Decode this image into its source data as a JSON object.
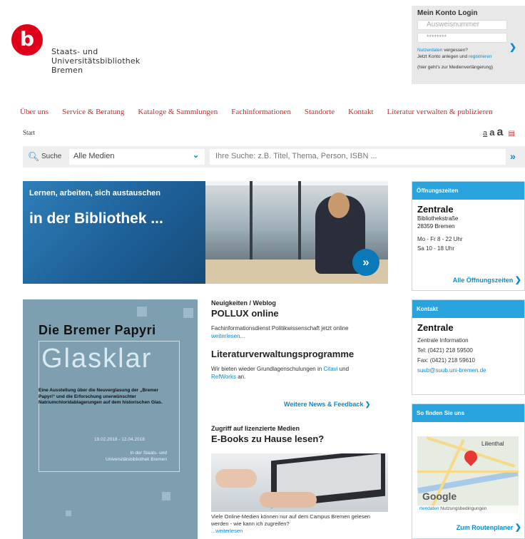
{
  "header": {
    "logo_letter": "b",
    "library_name_lines": [
      "Staats- und",
      "Universitätsbibliothek",
      "Bremen"
    ]
  },
  "login": {
    "title": "Mein Konto Login",
    "card_placeholder": "Ausweisnummer",
    "password_mask": "********",
    "line1_link": "Nutzerdaten",
    "line1_rest": " vergessen?",
    "line2_start": "Jetzt Konto anlegen und ",
    "line2_link": "registrieren",
    "line3": "(hier geht's zur Medienverlängerung)"
  },
  "nav": {
    "items": [
      "Über uns",
      "Service & Beratung",
      "Kataloge & Sammlungen",
      "Fachinformationen",
      "Standorte",
      "Kontakt",
      "Literatur verwalten & publizieren"
    ]
  },
  "breadcrumb": "Start",
  "font_size_controls": {
    "small": "a",
    "medium": "a",
    "large": "a"
  },
  "search": {
    "label": "Suche",
    "scope": "Alle Medien",
    "placeholder": "Ihre Suche: z.B. Titel, Thema, Person, ISBN ..."
  },
  "hero": {
    "line1": "Lernen, arbeiten, sich austauschen",
    "line2": "in der Bibliothek ..."
  },
  "poster": {
    "title": "Die Bremer Papyri",
    "headline": "Glasklar",
    "description": "Eine Ausstellung über die Neuverglasung der „Bremer Papyri“ und die Erforschung unerwünschter Natriumchloridablagerungen auf dem historischen Glas.",
    "dates": "19.02.2018 - 12.04.2018",
    "location": "In der Staats- und Universitätsbibliothek Bremen"
  },
  "news": {
    "category": "Neuigkeiten / Weblog",
    "item1_title": "POLLUX online",
    "item1_text": "Fachinformationsdienst Politikwissenschaft jetzt online",
    "item1_link": "weiterlesen...",
    "item2_title": "Literaturverwaltungsprogramme",
    "item2_text_start": "Wir bieten wieder Grundlagenschulungen in ",
    "item2_link1": "Citavi",
    "item2_text_mid": " und ",
    "item2_link2": "RefWorks",
    "item2_text_end": " an.",
    "more": "Weitere News & Feedback",
    "ebook_category": "Zugriff auf lizenzierte Medien",
    "ebook_title": "E-Books zu Hause lesen?",
    "ebook_text": "Viele Online-Medien können nur auf dem Campus Bremen gelesen werden - wie kann ich zugreifen?",
    "ebook_link": "...weiterlesen"
  },
  "hours_box": {
    "header": "Öffnungszeiten",
    "place": "Zentrale",
    "street": "Bibliothekstraße",
    "city": "28359 Bremen",
    "hours1": "Mo - Fr 8 - 22 Uhr",
    "hours2": "Sa 10 - 18 Uhr",
    "link": "Alle Öffnungszeiten"
  },
  "contact_box": {
    "header": "Kontakt",
    "place": "Zentrale",
    "info": "Zentrale Information",
    "phone": "Tel: (0421) 218 59500",
    "fax": "Fax: (0421) 218 59610",
    "email": "suub@suub.uni-bremen.de"
  },
  "map_box": {
    "header": "So finden Sie uns",
    "town": "Lilienthal",
    "google": "Google",
    "terms_link": "rtendaten",
    "terms": "Nutzungsbedingungen",
    "route": "Zum Routenplaner"
  }
}
